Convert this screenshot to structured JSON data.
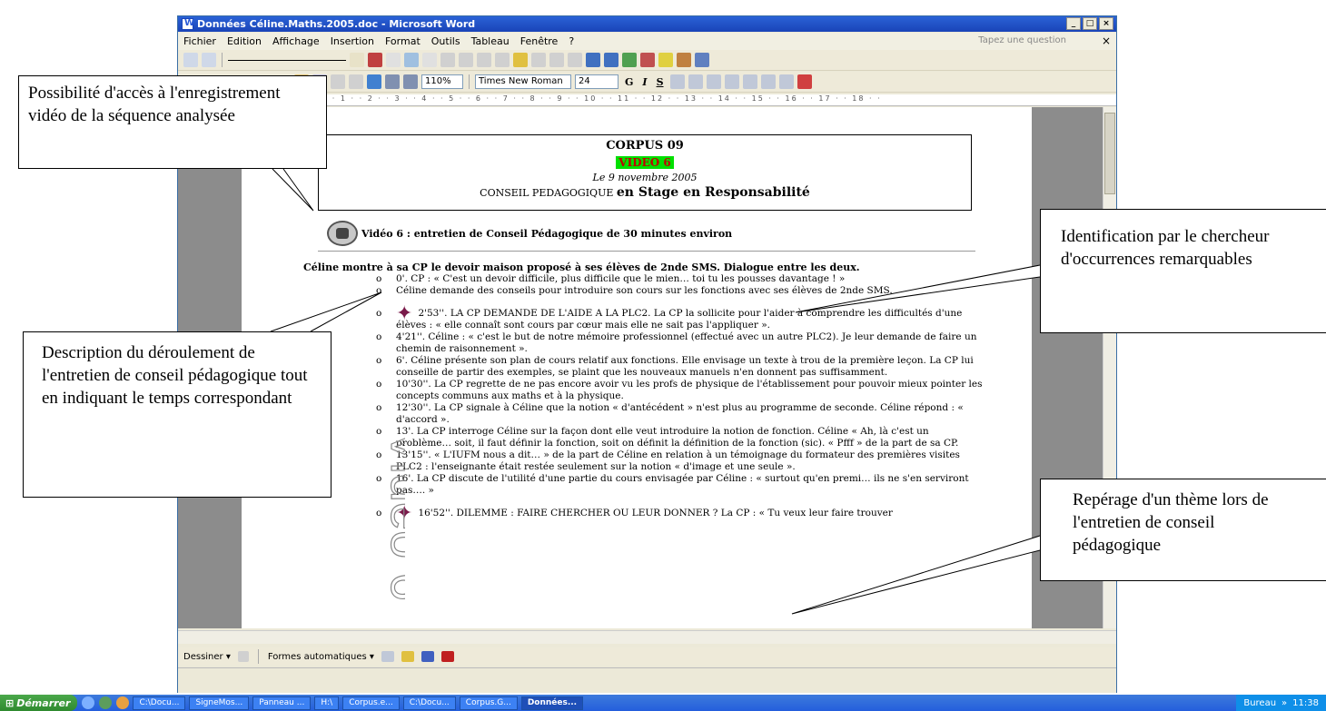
{
  "window": {
    "title": "Données Céline.Maths.2005.doc - Microsoft Word",
    "buttons": [
      "_",
      "□",
      "×"
    ]
  },
  "menu": {
    "items": [
      "Fichier",
      "Edition",
      "Affichage",
      "Insertion",
      "Format",
      "Outils",
      "Tableau",
      "Fenêtre",
      "?"
    ],
    "ask_placeholder": "Tapez une question"
  },
  "formatting": {
    "zoom": "110%",
    "font": "Times New Roman",
    "size": "24",
    "bold": "G",
    "italic": "I",
    "underline": "S"
  },
  "ruler": {
    "marks": "· 1 · · 1 · · 2 · · 3 · · 4 · · 5 · · 6 · · 7 · · 8 · · 9 · · 10 · · 11 · · 12 · · 13 · · 14 · · 15 · · 16 · · 17 · · 18 · ·"
  },
  "document": {
    "corpus": "CORPUS 09",
    "video": "VIDEO 6",
    "date": "Le 9 novembre 2005",
    "conseil_small": "CONSEIL PEDAGOGIQUE",
    "conseil_big": "en Stage en Responsabilité",
    "video_line": "Vidéo 6 : entretien de Conseil Pédagogique de 30 minutes environ",
    "intro": "Céline montre à sa CP le devoir maison proposé à ses élèves de 2nde SMS. Dialogue entre les deux.",
    "items": [
      {
        "text": "0'. CP : « C'est un devoir difficile, plus difficile que le mien… toi tu les pousses davantage ! »",
        "star": false
      },
      {
        "text": "Céline demande des conseils pour introduire son cours sur les fonctions avec ses élèves de 2nde SMS.",
        "star": false
      },
      {
        "text": "2'53''. LA CP DEMANDE DE L'AIDE A LA PLC2. La CP la sollicite pour l'aider à comprendre les difficultés d'une élèves : « elle connaît sont cours par cœur mais elle ne sait pas l'appliquer ».",
        "star": true
      },
      {
        "text": "4'21''. Céline : « c'est le but de notre mémoire professionnel (effectué avec un autre PLC2). Je leur demande de faire un chemin de raisonnement ».",
        "star": false
      },
      {
        "text": "6'. Céline présente son plan de cours relatif aux fonctions. Elle envisage un texte à trou de la première leçon. La CP lui conseille de partir des exemples, se plaint que les nouveaux manuels n'en donnent pas suffisamment.",
        "star": false
      },
      {
        "text": "10'30''. La CP regrette de ne pas encore avoir vu les profs de physique de l'établissement pour pouvoir mieux pointer les concepts communs aux maths et à la physique.",
        "star": false
      },
      {
        "text": "12'30''. La CP signale à Céline que la notion « d'antécédent » n'est plus au programme de seconde. Céline répond : « d'accord ».",
        "star": false
      },
      {
        "text": "13'. La CP interroge Céline sur la façon dont elle veut introduire la notion de fonction. Céline « Ah, là c'est un problème… soit, il faut définir la fonction, soit on définit la définition de la fonction (sic). « Pfff » de la part de sa CP.",
        "star": false
      },
      {
        "text": "13'15''. « L'IUFM nous a dit… » de la part de Céline en relation à un témoignage du formateur des premières visites PLC2 : l'enseignante était restée seulement sur la notion « d'image et une seule ».",
        "star": false
      },
      {
        "text": "16'. La CP discute de l'utilité d'une partie du cours envisagée par Céline : « surtout qu'en premi… ils ne s'en serviront pas…. »",
        "star": false
      },
      {
        "text": "16'52''. DILEMME : FAIRE CHERCHER OU LEUR DONNER ? La CP : « Tu veux leur faire trouver",
        "star": true
      }
    ],
    "watermark": "Vidéo 6"
  },
  "callouts": {
    "video_access": "Possibilité d'accès à l'enregistrement vidéo de la séquence analysée",
    "identification": "Identification par le chercheur d'occurrences remarquables",
    "description": "Description du déroulement de l'entretien de conseil pédagogique tout en indiquant le temps correspondant",
    "theme": "Repérage d'un thème lors de l'entretien de conseil pédagogique"
  },
  "drawbar": {
    "draw": "Dessiner ▾",
    "autoshapes": "Formes automatiques ▾"
  },
  "taskbar": {
    "start": "Démarrer",
    "items": [
      "C:\\Docu...",
      "SigneMos...",
      "Panneau ...",
      "H:\\",
      "Corpus.e...",
      "C:\\Docu...",
      "Corpus.G...",
      "Données..."
    ],
    "tray_label": "Bureau",
    "clock": "11:38"
  }
}
